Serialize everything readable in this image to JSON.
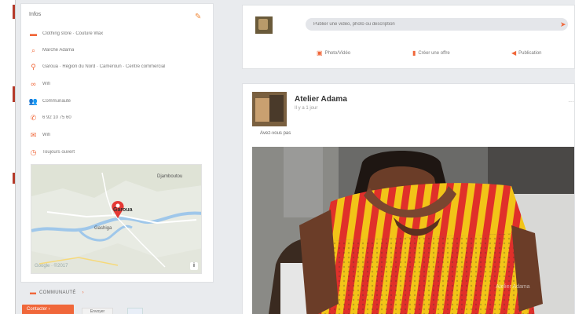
{
  "colors": {
    "accent": "#f0673a",
    "page_bg": "#e9ebee",
    "card_bg": "#ffffff"
  },
  "about": {
    "title": "Infos",
    "edit_icon": "pencil-icon",
    "rows": [
      {
        "icon": "briefcase-icon",
        "glyph": "▬",
        "text": "Clothing store  · Couture  Wax"
      },
      {
        "icon": "search-icon",
        "glyph": "⌕",
        "text": "Marché Adama"
      },
      {
        "icon": "location-pin-icon",
        "glyph": "⚲",
        "text": "Garoua · Région du Nord · Cameroun  ·  Centre commercial"
      },
      {
        "icon": "link-icon",
        "glyph": "∞",
        "text": "Wifi"
      },
      {
        "icon": "people-icon",
        "glyph": "👥",
        "text": "Communauté"
      },
      {
        "icon": "phone-icon",
        "glyph": "✆",
        "text": "6 92 10 75 60"
      },
      {
        "icon": "envelope-icon",
        "glyph": "✉",
        "text": "Wifi"
      },
      {
        "icon": "clock-icon",
        "glyph": "◷",
        "text": "Toujours ouvert"
      }
    ],
    "map": {
      "city": "Garoua",
      "labels": [
        "Djamboutou",
        "Gashiga"
      ],
      "attribution": "Google  ·  ©2017",
      "info_label": "i"
    }
  },
  "community": {
    "label": "COMMUNAUTÉ",
    "chevron": "›"
  },
  "bottom_buttons": {
    "primary": "Contacter  ›",
    "secondary": "Envoyer"
  },
  "composer": {
    "placeholder": "Publier une vidéo, photo ou description",
    "actions": [
      {
        "icon": "camera-icon",
        "glyph": "▣",
        "label": "Photo/Vidéo"
      },
      {
        "icon": "document-icon",
        "glyph": "▮",
        "label": "Créer une offre"
      },
      {
        "icon": "star-icon",
        "glyph": "◀",
        "label": "Publication"
      }
    ]
  },
  "post": {
    "author": "Atelier Adama",
    "time": "Il y a 1 jour",
    "text": "Avez-vous pas",
    "menu": "…",
    "photo_watermark": "Atelier Adama"
  }
}
